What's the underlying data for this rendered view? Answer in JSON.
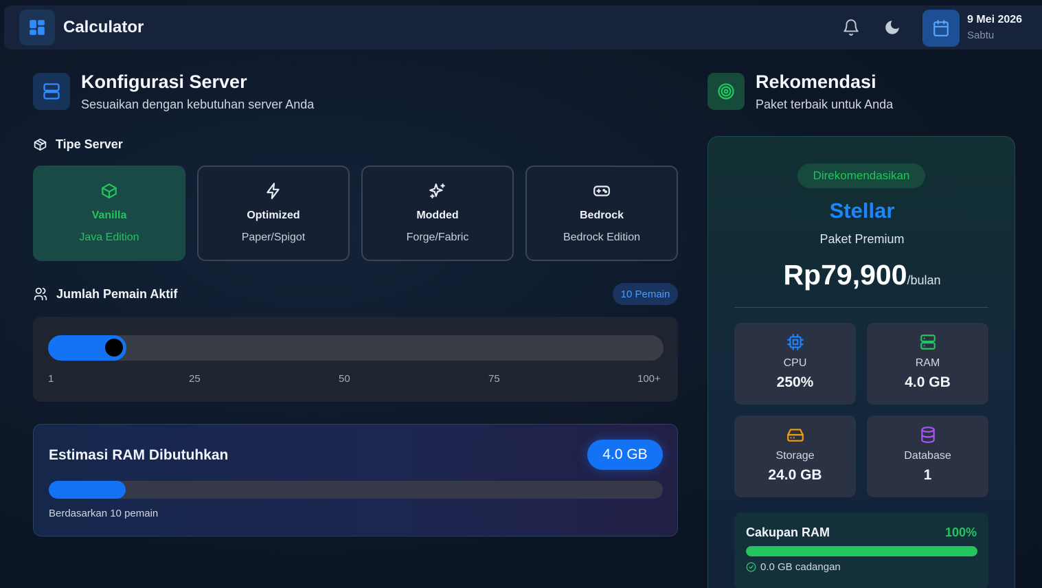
{
  "app": {
    "title": "Calculator"
  },
  "header": {
    "date": "9 Mei 2026",
    "day": "Sabtu"
  },
  "config": {
    "title": "Konfigurasi Server",
    "subtitle": "Sesuaikan dengan kebutuhan server Anda",
    "server_type_label": "Tipe Server",
    "types": [
      {
        "name": "Vanilla",
        "sub": "Java Edition",
        "icon": "cube-icon",
        "selected": true
      },
      {
        "name": "Optimized",
        "sub": "Paper/Spigot",
        "icon": "lightning-icon",
        "selected": false
      },
      {
        "name": "Modded",
        "sub": "Forge/Fabric",
        "icon": "sparkles-icon",
        "selected": false
      },
      {
        "name": "Bedrock",
        "sub": "Bedrock Edition",
        "icon": "gamepad-icon",
        "selected": false
      }
    ],
    "players_label": "Jumlah Pemain Aktif",
    "players_badge": "10 Pemain",
    "players_value": 10,
    "slider_ticks": [
      "1",
      "25",
      "50",
      "75",
      "100+"
    ]
  },
  "ram_estimate": {
    "title": "Estimasi RAM Dibutuhkan",
    "value": "4.0 GB",
    "fill_fraction": 0.125,
    "note": "Berdasarkan 10 pemain"
  },
  "recommendation": {
    "title": "Rekomendasi",
    "subtitle": "Paket terbaik untuk Anda",
    "badge": "Direkomendasikan",
    "plan": "Stellar",
    "tier": "Paket Premium",
    "price": "Rp79,900",
    "period": "/bulan",
    "specs": [
      {
        "label": "CPU",
        "value": "250%",
        "icon": "cpu-icon",
        "color": "#1f85ff"
      },
      {
        "label": "RAM",
        "value": "4.0 GB",
        "icon": "server-icon",
        "color": "#22c55e"
      },
      {
        "label": "Storage",
        "value": "24.0 GB",
        "icon": "harddrive-icon",
        "color": "#f59e0b"
      },
      {
        "label": "Database",
        "value": "1",
        "icon": "database-icon",
        "color": "#a855f7"
      }
    ],
    "coverage": {
      "title": "Cakupan RAM",
      "percent": "100%",
      "fill_fraction": 1.0,
      "note": "0.0 GB cadangan"
    }
  },
  "colors": {
    "accent": "#1473f5",
    "success": "#22c55e",
    "warning": "#f59e0b",
    "purple": "#a855f7"
  }
}
